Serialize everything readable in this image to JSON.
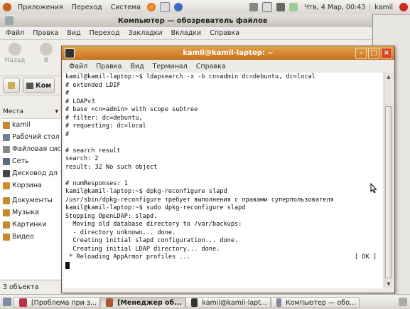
{
  "top_panel": {
    "menus": [
      "Приложения",
      "Переход",
      "Система"
    ],
    "clock": "Чтв, 4 Мар, 00:43",
    "user": "kamil"
  },
  "file_manager": {
    "title": "Компьютер — обозреватель файлов",
    "menu": [
      "Файл",
      "Правка",
      "Вид",
      "Переход",
      "Закладки",
      "Вкладки",
      "Справка"
    ],
    "toolbar": {
      "back": "Назад",
      "forward": "В"
    },
    "location": "Ком",
    "sidebar_header": "Места",
    "sidebar_items": [
      "kamil",
      "Рабочий стол",
      "Файловая сис",
      "Сеть",
      "Дисковод дл",
      "Корзина"
    ],
    "bookmarks": [
      "Документы",
      "Музыка",
      "Картинки",
      "Видео"
    ],
    "status": "3 объекта"
  },
  "terminal": {
    "title": "kamil@kamil-laptop: ~",
    "menu": [
      "Файл",
      "Правка",
      "Вид",
      "Терминал",
      "Справка"
    ],
    "lines": [
      "kamil@kamil-laptop:~$ ldapsearch -x -b cn=admin dc=debuntu, dc=local",
      "# extended LDIF",
      "#",
      "# LDAPv3",
      "# base <cn=admin> with scope subtree",
      "# filter: dc=debuntu,",
      "# requesting: dc=local",
      "#",
      "",
      "# search result",
      "search: 2",
      "result: 32 No such object",
      "",
      "# numResponses: 1",
      "kamil@kamil-laptop:~$ dpkg-reconfigure slapd",
      "/usr/sbin/dpkg-reconfigure требует выполнения с правами суперпользователя",
      "kamil@kamil-laptop:~$ sudo dpkg-reconfigure slapd",
      "Stopping OpenLDAP: slapd.",
      "  Moving old database directory to /var/backups:",
      "  - directory unknown... done.",
      "  Creating initial slapd configuration... done.",
      "  Creating initial LDAP directory... done.",
      " * Reloading AppArmor profiles ..."
    ],
    "ok_label": "[ OK ]"
  },
  "taskbar": {
    "tasks": [
      "[Проблема при з...",
      "[Менеджер об...",
      "kamil@kamil-lapt...",
      "Компьютер — обо..."
    ]
  },
  "colors": {
    "terminal_title": "#d4832a",
    "accent_orange": "#e07a22"
  }
}
